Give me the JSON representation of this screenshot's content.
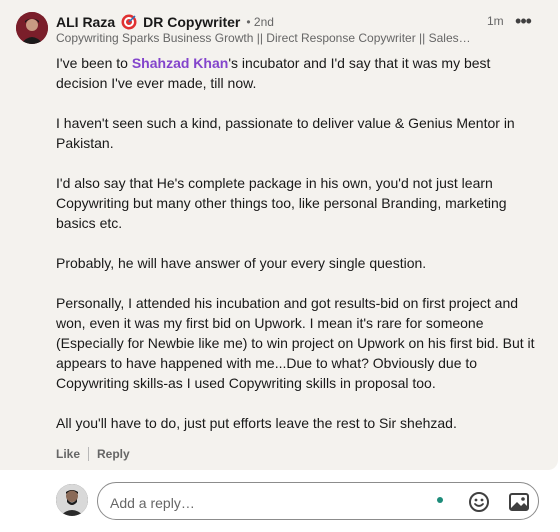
{
  "comment": {
    "author_name": "ALI Raza",
    "author_suffix": "DR Copywriter",
    "degree": "• 2nd",
    "headline": "Copywriting Sparks Business Growth || Direct Response Copywriter || Sales E...",
    "time": "1m",
    "more_label": "•••",
    "body": {
      "p1_before": "I've been to ",
      "p1_mention": "Shahzad Khan",
      "p1_after": "'s incubator and I'd say that it was my best decision I've ever made, till now.",
      "p2": "I haven't seen such a kind, passionate to deliver value & Genius Mentor in Pakistan.",
      "p3": "I'd also say that He's complete package in his own, you'd not just learn Copywriting but many other things too, like personal Branding, marketing basics etc.",
      "p4": "Probably, he will have answer of your every single question.",
      "p5": "Personally, I attended his incubation and got results-bid on first project and won, even it was my first bid on Upwork. I mean it's rare for someone (Especially for Newbie like me) to win project on Upwork on his first bid. But it appears to have happened with me...Due to what? Obviously due to Copywriting skills-as I used Copywriting skills in proposal too.",
      "p6": "All you'll have to do, just put efforts leave the rest to Sir shehzad."
    },
    "actions": {
      "like": "Like",
      "reply": "Reply"
    }
  },
  "reply_box": {
    "placeholder": "Add a reply…",
    "value": ""
  },
  "icons": {
    "target": "dart-target-icon",
    "more": "ellipsis-icon",
    "emoji": "emoji-icon",
    "image": "image-icon",
    "status_dot": "status-dot-icon"
  },
  "colors": {
    "card_bg": "#f4f2ee",
    "mention": "#8344cc",
    "muted": "#666666",
    "text": "#191919",
    "status_dot": "#1d8c7a"
  }
}
